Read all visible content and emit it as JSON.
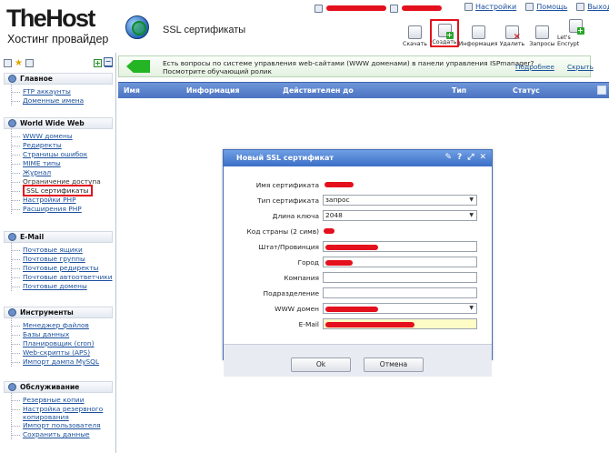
{
  "brand": {
    "logo_title": "TheHost",
    "logo_subtitle": "Хостинг провайдер"
  },
  "page_title": "SSL сертификаты",
  "top_links": {
    "settings": "Настройки",
    "help": "Помощь",
    "exit": "Выход"
  },
  "toolbar": [
    {
      "label": "Скачать",
      "icon": "download-icon"
    },
    {
      "label": "Создать",
      "icon": "create-icon",
      "highlighted": true
    },
    {
      "label": "Информация",
      "icon": "info-icon"
    },
    {
      "label": "Удалить",
      "icon": "delete-icon"
    },
    {
      "label": "Запросы",
      "icon": "requests-icon"
    },
    {
      "label": "Let's Encrypt",
      "icon": "letsencrypt-icon"
    }
  ],
  "sidebar": {
    "sections": [
      {
        "title": "Главное",
        "items": [
          "FTP аккаунты",
          "Доменные имена"
        ]
      },
      {
        "title": "World Wide Web",
        "items": [
          "WWW домены",
          "Редиректы",
          "Страницы ошибок",
          "MIME типы",
          "Журнал",
          "Ограничение доступа",
          "SSL сертификаты",
          "Настройки PHP",
          "Расширения PHP"
        ],
        "active": "SSL сертификаты",
        "plain": [
          "Ограничение доступа"
        ]
      },
      {
        "title": "E-Mail",
        "items": [
          "Почтовые ящики",
          "Почтовые группы",
          "Почтовые редиректы",
          "Почтовые автоответчики",
          "Почтовые домены"
        ]
      },
      {
        "title": "Инструменты",
        "items": [
          "Менеджер файлов",
          "Базы данных",
          "Планировщик (cron)",
          "Web-скрипты (APS)",
          "Импорт дампа MySQL"
        ]
      },
      {
        "title": "Обслуживание",
        "items": [
          "Резервные копии",
          "Настройка резервного копирования",
          "Импорт пользователя",
          "Сохранить данные"
        ]
      }
    ]
  },
  "banner": {
    "line1": "Есть вопросы по системе управления web-сайтами (WWW доменами) в панели управления ISPmanager?",
    "line2": "Посмотрите обучающий ролик",
    "more": "Подробнее",
    "hide": "Скрыть"
  },
  "table": {
    "columns": [
      "Имя",
      "Информация",
      "Действителен до",
      "Тип",
      "Статус"
    ]
  },
  "modal": {
    "title": "Новый SSL сертификат",
    "fields": [
      {
        "label": "Имя сертификата",
        "value": "",
        "redacted": true
      },
      {
        "label": "Тип сертификата",
        "value": "запрос",
        "type": "select"
      },
      {
        "label": "Длина ключа",
        "value": "2048",
        "type": "select"
      },
      {
        "label": "Код страны (2 симв)",
        "value": "",
        "redacted": true
      },
      {
        "label": "Штат/Провинция",
        "value": "",
        "redacted": true
      },
      {
        "label": "Город",
        "value": "",
        "redacted": true
      },
      {
        "label": "Компания",
        "value": ""
      },
      {
        "label": "Подразделение",
        "value": ""
      },
      {
        "label": "WWW домен",
        "value": "",
        "type": "select",
        "redacted": true
      },
      {
        "label": "E-Mail",
        "value": "",
        "redacted": true,
        "highlight": true
      }
    ],
    "ok": "Ok",
    "cancel": "Отмена"
  },
  "colors": {
    "accent": "#4a73c2",
    "highlight": "#e4101d",
    "banner_green": "#24b424"
  }
}
